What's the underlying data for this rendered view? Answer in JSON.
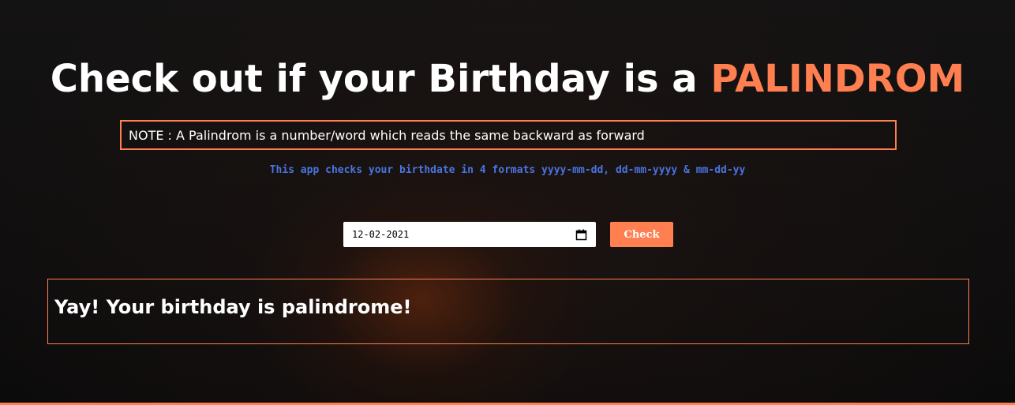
{
  "header": {
    "title_prefix": "Check out if your Birthday is a ",
    "title_highlight": "PALINDROM"
  },
  "note": {
    "text": "NOTE : A Palindrom is a number/word which reads the same backward as forward"
  },
  "info": {
    "formats_text": "This app checks your birthdate in 4 formats yyyy-mm-dd, dd-mm-yyyy & mm-dd-yy"
  },
  "form": {
    "date_value": "12-02-2021",
    "date_icon": "calendar-icon",
    "check_label": "Check"
  },
  "result": {
    "message": "Yay! Your birthday is palindrome!"
  },
  "colors": {
    "accent": "#ff7f50",
    "info_text": "#4a74e0",
    "background": "#0c0b0b",
    "text": "#ffffff"
  }
}
